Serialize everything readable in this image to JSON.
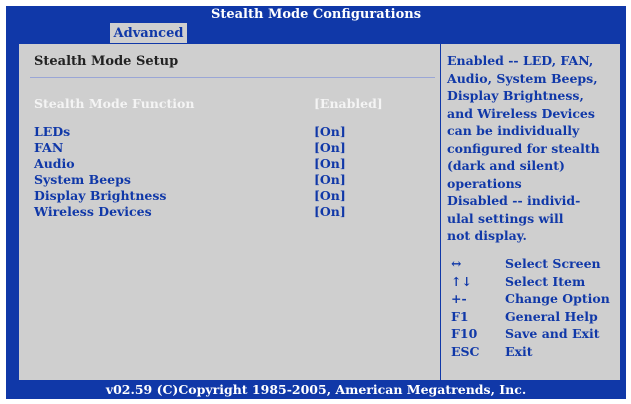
{
  "title": "Stealth Mode Configurations",
  "tabs": [
    {
      "label": "Advanced"
    }
  ],
  "section_title": "Stealth Mode Setup",
  "settings": [
    {
      "label": "Stealth Mode Function",
      "value": "[Enabled]"
    },
    {
      "label": "LEDs",
      "value": "[On]"
    },
    {
      "label": "FAN",
      "value": "[On]"
    },
    {
      "label": "Audio",
      "value": "[On]"
    },
    {
      "label": "System Beeps",
      "value": "[On]"
    },
    {
      "label": "Display Brightness",
      "value": "[On]"
    },
    {
      "label": "Wireless Devices",
      "value": "[On]"
    }
  ],
  "help_lines": [
    "Enabled -- LED, FAN,",
    "Audio, System Beeps,",
    "Display Brightness,",
    "and Wireless Devices",
    "can be individually",
    "configured for stealth",
    "(dark and silent)",
    "operations",
    "Disabled -- individ-",
    "ulal settings will",
    "not display."
  ],
  "keys": [
    {
      "key": "↔",
      "desc": "Select Screen"
    },
    {
      "key": "↑↓",
      "desc": "Select Item"
    },
    {
      "key": "+-",
      "desc": "Change Option"
    },
    {
      "key": "F1",
      "desc": "General Help"
    },
    {
      "key": "F10",
      "desc": "Save and Exit"
    },
    {
      "key": "ESC",
      "desc": "Exit"
    }
  ],
  "footer": "v02.59 (C)Copyright 1985-2005, American Megatrends, Inc.",
  "colors": {
    "background": "#1038a8",
    "panel": "#cfcfcf",
    "text": "#1038a8",
    "highlight": "#f4f4f4"
  }
}
